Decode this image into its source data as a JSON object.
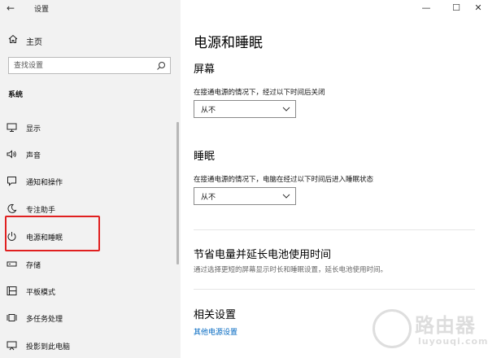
{
  "window": {
    "title": "设置",
    "controls": {
      "minimize": "—",
      "maximize": "☐",
      "close": "✕"
    },
    "back_glyph": "←"
  },
  "sidebar": {
    "home_label": "主页",
    "search_placeholder": "查找设置",
    "section_label": "系统",
    "items": [
      {
        "label": "显示",
        "icon": "display-icon"
      },
      {
        "label": "声音",
        "icon": "speaker-icon"
      },
      {
        "label": "通知和操作",
        "icon": "notification-icon"
      },
      {
        "label": "专注助手",
        "icon": "moon-icon"
      },
      {
        "label": "电源和睡眠",
        "icon": "power-icon",
        "selected": true
      },
      {
        "label": "存储",
        "icon": "storage-icon"
      },
      {
        "label": "平板模式",
        "icon": "tablet-icon"
      },
      {
        "label": "多任务处理",
        "icon": "multitask-icon"
      },
      {
        "label": "投影到此电脑",
        "icon": "projector-icon"
      }
    ]
  },
  "main": {
    "title": "电源和睡眠",
    "screen": {
      "heading": "屏幕",
      "description": "在接通电源的情况下，经过以下时间后关闭",
      "value": "从不"
    },
    "sleep": {
      "heading": "睡眠",
      "description": "在接通电源的情况下，电脑在经过以下时间后进入睡眠状态",
      "value": "从不"
    },
    "battery": {
      "heading": "节省电量并延长电池使用时间",
      "description": "通过选择更短的屏幕显示时长和睡眠设置，延长电池使用时间。"
    },
    "related": {
      "heading": "相关设置",
      "link": "其他电源设置"
    }
  },
  "watermark": {
    "text": "路由器",
    "sub": "luyouqi.com"
  },
  "colors": {
    "accent": "#0067c0",
    "highlight": "#e02020",
    "sidebar_bg": "#f2f2f2"
  }
}
